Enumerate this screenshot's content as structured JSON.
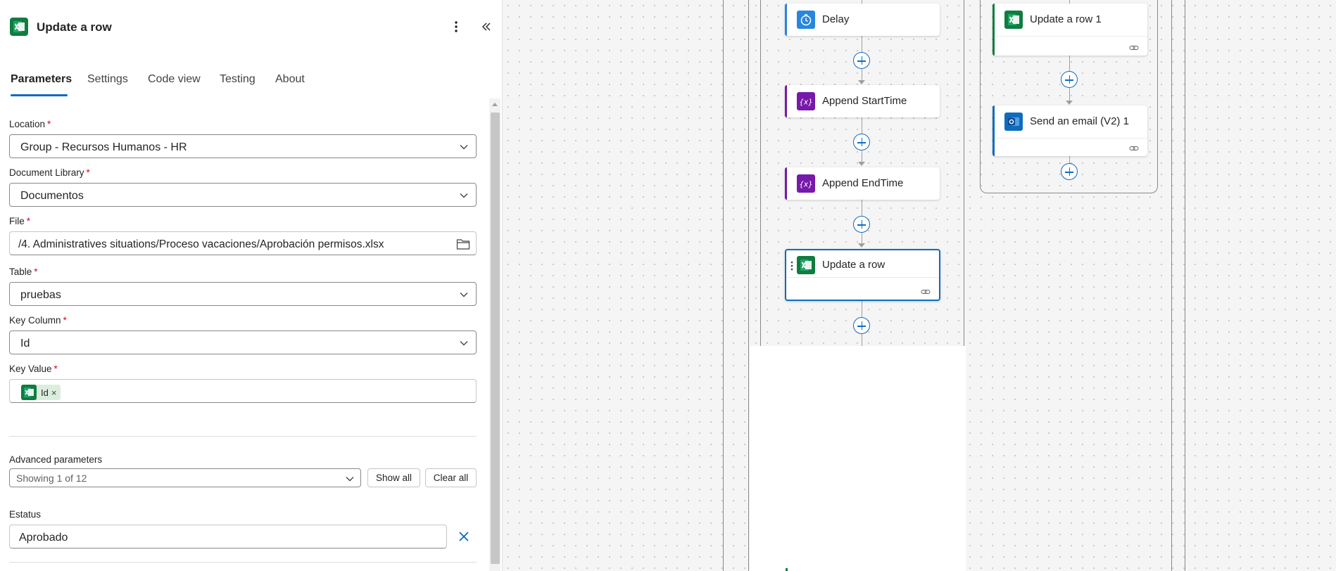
{
  "panel": {
    "title": "Update a row",
    "tabs": [
      {
        "label": "Parameters",
        "active": true
      },
      {
        "label": "Settings"
      },
      {
        "label": "Code view"
      },
      {
        "label": "Testing"
      },
      {
        "label": "About"
      }
    ],
    "required_mark": "*",
    "fields": {
      "location": {
        "label": "Location",
        "value": "Group - Recursos Humanos - HR"
      },
      "library": {
        "label": "Document Library",
        "value": "Documentos"
      },
      "file": {
        "label": "File",
        "value": "/4. Administratives situations/Proceso vacaciones/Aprobación permisos.xlsx"
      },
      "table": {
        "label": "Table",
        "value": "pruebas"
      },
      "key_column": {
        "label": "Key Column",
        "value": "Id"
      },
      "key_value": {
        "label": "Key Value",
        "token": "Id",
        "token_remove": "×"
      }
    },
    "advanced": {
      "label": "Advanced parameters",
      "selected": "Showing 1 of 12",
      "show_all": "Show all",
      "clear_all": "Clear all"
    },
    "estatus": {
      "label": "Estatus",
      "value": "Aprobado"
    }
  },
  "canvas": {
    "nodes": {
      "delay": "Delay",
      "append_start": "Append StartTime",
      "append_end": "Append EndTime",
      "update_row": "Update a row",
      "update_row_1": "Update a row 1",
      "send_email": "Send an email (V2) 1"
    }
  },
  "colors": {
    "accent": "#0f6cbd",
    "excel": "#107c41",
    "variable": "#7719aa",
    "delay": "#2886de",
    "outlook": "#0f6cbd",
    "required": "#c50f1f"
  },
  "icons": [
    "excel-icon",
    "more-vertical-icon",
    "collapse-panel-icon",
    "chevron-down-icon",
    "folder-icon",
    "dismiss-icon",
    "timer-icon",
    "variable-icon",
    "outlook-icon",
    "link-icon",
    "plus-icon",
    "drag-handle-icon"
  ]
}
